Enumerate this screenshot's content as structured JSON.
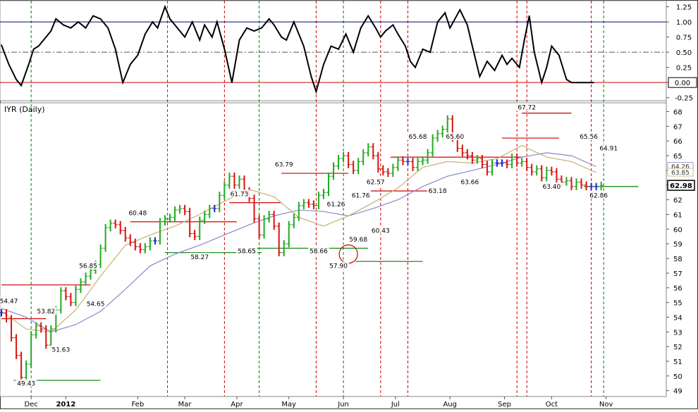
{
  "chart_data": [
    {
      "type": "line",
      "panel": "oscillator",
      "title": "",
      "y_ticks": [
        "1.25",
        "1.00",
        "0.75",
        "0.50",
        "0.25",
        "0.00",
        "-0.25"
      ],
      "ylim": [
        -0.3,
        1.35
      ],
      "reference_lines": [
        {
          "value": 1.0,
          "style": "solid",
          "color": "#000080"
        },
        {
          "value": 0.5,
          "style": "dashdot",
          "color": "#555555"
        },
        {
          "value": 0.0,
          "style": "solid",
          "color": "#cc0000"
        }
      ],
      "current_value_label": "0.00",
      "series": [
        {
          "x": [
            0,
            3,
            6,
            8,
            11,
            13,
            15,
            17,
            20,
            22,
            25,
            28,
            31,
            34,
            37,
            40,
            43,
            46,
            49,
            52,
            55,
            58,
            61,
            63,
            66,
            68,
            71,
            74,
            77,
            80,
            82,
            85,
            87,
            90,
            93,
            96,
            99,
            102,
            105,
            108,
            110,
            113,
            115,
            118,
            120,
            122,
            125,
            127,
            130,
            133,
            136,
            139,
            142,
            145,
            148,
            151,
            153,
            155,
            158,
            160,
            163,
            165,
            167,
            170,
            173,
            176,
            179,
            181,
            183,
            185,
            188,
            190,
            193,
            196,
            199,
            202,
            204,
            206,
            209,
            211,
            213,
            215,
            218,
            220,
            222,
            225,
            228,
            230,
            232,
            234,
            236,
            239
          ],
          "values": [
            0.62,
            0.3,
            0.05,
            -0.05,
            0.3,
            0.55,
            0.6,
            0.7,
            0.85,
            1.05,
            0.95,
            0.9,
            1.0,
            0.9,
            1.1,
            1.05,
            0.9,
            0.55,
            0.0,
            0.3,
            0.45,
            0.8,
            1.0,
            0.9,
            1.25,
            1.05,
            0.9,
            0.75,
            1.0,
            0.7,
            0.95,
            0.75,
            1.0,
            0.55,
            0.0,
            0.7,
            0.9,
            0.85,
            0.9,
            1.05,
            0.95,
            0.75,
            0.7,
            1.0,
            0.8,
            0.6,
            0.1,
            -0.15,
            0.3,
            0.6,
            0.55,
            0.8,
            0.5,
            0.9,
            1.1,
            0.9,
            0.75,
            0.85,
            0.95,
            0.8,
            0.6,
            0.35,
            0.25,
            0.55,
            0.5,
            1.0,
            1.15,
            0.9,
            1.05,
            1.2,
            0.95,
            0.6,
            0.1,
            0.35,
            0.2,
            0.45,
            0.3,
            0.4,
            0.25,
            0.7,
            1.1,
            0.5,
            0.0,
            0.25,
            0.6,
            0.45,
            0.05,
            0.0,
            0.0,
            0.0,
            0.0,
            0.0
          ]
        }
      ]
    },
    {
      "type": "line",
      "panel": "price",
      "title": "IYR (Daily)",
      "x_ticks": [
        {
          "label": "Dec",
          "x": 12
        },
        {
          "label": "2012",
          "x": 26
        },
        {
          "label": "Feb",
          "x": 55
        },
        {
          "label": "Mar",
          "x": 74
        },
        {
          "label": "Apr",
          "x": 95
        },
        {
          "label": "May",
          "x": 116
        },
        {
          "label": "Jun",
          "x": 138
        },
        {
          "label": "Jul",
          "x": 159
        },
        {
          "label": "Aug",
          "x": 181
        },
        {
          "label": "Sep",
          "x": 203
        },
        {
          "label": "Oct",
          "x": 222
        },
        {
          "label": "Nov",
          "x": 244
        }
      ],
      "xlim": [
        0,
        264
      ],
      "ylim": [
        48.6,
        68.6
      ],
      "y_ticks": [
        "68",
        "67",
        "66",
        "65",
        "64",
        "63",
        "62",
        "61",
        "60",
        "59",
        "58",
        "57",
        "56",
        "55",
        "54",
        "53",
        "52",
        "51",
        "50",
        "49"
      ],
      "series": [
        {
          "name": "",
          "x": [
            0,
            2,
            4,
            6,
            8,
            10,
            12,
            14,
            16,
            18,
            20,
            22,
            24,
            26,
            28,
            30,
            32,
            34,
            36,
            38,
            40,
            42,
            44,
            46,
            48,
            50,
            52,
            54,
            56,
            58,
            60,
            62,
            64,
            66,
            68,
            70,
            72,
            74,
            76,
            78,
            80,
            82,
            84,
            86,
            88,
            90,
            92,
            94,
            96,
            98,
            100,
            102,
            104,
            106,
            108,
            110,
            112,
            114,
            116,
            118,
            120,
            122,
            124,
            126,
            128,
            130,
            132,
            134,
            136,
            138,
            140,
            142,
            144,
            146,
            148,
            150,
            152,
            154,
            156,
            158,
            160,
            162,
            164,
            166,
            168,
            170,
            172,
            174,
            176,
            178,
            180,
            182,
            184,
            186,
            188,
            190,
            192,
            194,
            196,
            198,
            200,
            202,
            204,
            206,
            208,
            210,
            212,
            214,
            216,
            218,
            220,
            222,
            224,
            226,
            228,
            230,
            232,
            234,
            236,
            238,
            240,
            242
          ],
          "values": [
            54.3,
            53.9,
            52.6,
            51.4,
            49.9,
            50.8,
            52.8,
            53.4,
            53.2,
            52.1,
            53.2,
            54.5,
            55.8,
            55.4,
            55.0,
            55.9,
            56.4,
            56.8,
            57.2,
            57.6,
            58.7,
            60.1,
            60.4,
            60.3,
            59.9,
            59.4,
            59.1,
            58.8,
            58.6,
            58.8,
            59.2,
            59.2,
            60.5,
            60.7,
            60.8,
            61.3,
            61.4,
            61.2,
            59.7,
            59.5,
            60.6,
            61.0,
            61.4,
            61.4,
            62.3,
            63.0,
            63.6,
            63.0,
            63.4,
            62.6,
            62.1,
            60.7,
            59.6,
            60.7,
            61.0,
            60.2,
            58.4,
            59.0,
            60.3,
            60.8,
            61.6,
            61.8,
            61.7,
            61.6,
            62.3,
            62.5,
            63.6,
            64.3,
            64.8,
            65.0,
            64.4,
            64.0,
            64.6,
            65.2,
            65.6,
            65.0,
            64.1,
            63.9,
            63.8,
            64.2,
            64.7,
            64.6,
            64.6,
            64.2,
            64.6,
            64.7,
            65.2,
            66.2,
            66.5,
            66.8,
            67.5,
            66.2,
            65.5,
            65.2,
            65.0,
            64.7,
            64.8,
            64.4,
            63.9,
            64.5,
            64.5,
            64.5,
            64.4,
            64.9,
            64.5,
            64.6,
            64.2,
            63.9,
            64.1,
            63.5,
            64.0,
            63.9,
            63.4,
            63.2,
            63.3,
            62.9,
            63.2,
            63.0,
            62.9,
            62.9,
            62.9,
            62.98
          ]
        },
        {
          "name": "",
          "x": [
            0,
            10,
            20,
            30,
            40,
            50,
            60,
            70,
            80,
            90,
            100,
            110,
            120,
            130,
            140,
            150,
            160,
            170,
            180,
            190,
            200,
            210,
            220,
            230,
            240
          ],
          "values": [
            54.4,
            53.2,
            53.0,
            54.5,
            56.8,
            58.9,
            59.6,
            60.2,
            61.0,
            61.9,
            62.7,
            62.2,
            60.8,
            60.2,
            60.9,
            61.8,
            62.8,
            64.2,
            64.6,
            64.5,
            64.8,
            65.7,
            64.9,
            64.6,
            63.85
          ]
        },
        {
          "name": "",
          "x": [
            0,
            10,
            20,
            30,
            40,
            50,
            60,
            70,
            80,
            90,
            100,
            110,
            120,
            130,
            140,
            150,
            160,
            170,
            180,
            190,
            200,
            210,
            220,
            230,
            240
          ],
          "values": [
            54.6,
            54.0,
            53.0,
            53.5,
            54.4,
            55.9,
            57.5,
            58.3,
            58.9,
            59.6,
            60.3,
            60.9,
            61.3,
            61.2,
            60.9,
            61.4,
            62.0,
            62.9,
            63.6,
            64.0,
            64.4,
            64.9,
            65.2,
            65.0,
            64.26
          ]
        }
      ],
      "last_price_label": "62.98",
      "right_labels": [
        "64.26",
        "63.85"
      ],
      "annotations": [
        {
          "label": "54.47",
          "x": 3,
          "y": 55.0
        },
        {
          "label": "53.82",
          "x": 18,
          "y": 54.3
        },
        {
          "label": "49.43",
          "x": 10,
          "y": 49.4
        },
        {
          "label": "51.63",
          "x": 24,
          "y": 51.7
        },
        {
          "label": "56.85",
          "x": 35,
          "y": 57.4
        },
        {
          "label": "54.65",
          "x": 38,
          "y": 54.8
        },
        {
          "label": "60.48",
          "x": 55,
          "y": 61.0
        },
        {
          "label": "58.27",
          "x": 80,
          "y": 58.0
        },
        {
          "label": "61.73",
          "x": 96,
          "y": 62.3
        },
        {
          "label": "58.65",
          "x": 99,
          "y": 58.4
        },
        {
          "label": "63.79",
          "x": 114,
          "y": 64.3
        },
        {
          "label": "58.66",
          "x": 128,
          "y": 58.4
        },
        {
          "label": "61.26",
          "x": 135,
          "y": 61.6
        },
        {
          "label": "59.68",
          "x": 144,
          "y": 59.2
        },
        {
          "label": "57.90",
          "x": 136,
          "y": 57.4
        },
        {
          "label": "61.76",
          "x": 145,
          "y": 62.2
        },
        {
          "label": "62.57",
          "x": 151,
          "y": 63.1
        },
        {
          "label": "60.43",
          "x": 153,
          "y": 59.8
        },
        {
          "label": "65.68",
          "x": 168,
          "y": 66.2
        },
        {
          "label": "63.18",
          "x": 176,
          "y": 62.5
        },
        {
          "label": "65.60",
          "x": 183,
          "y": 66.2
        },
        {
          "label": "63.66",
          "x": 189,
          "y": 63.1
        },
        {
          "label": "67.72",
          "x": 212,
          "y": 68.2
        },
        {
          "label": "63.40",
          "x": 222,
          "y": 62.8
        },
        {
          "label": "65.56",
          "x": 237,
          "y": 66.2
        },
        {
          "label": "64.91",
          "x": 245,
          "y": 65.4
        },
        {
          "label": "62.86",
          "x": 241,
          "y": 62.2
        }
      ],
      "support_resistance_lines": [
        {
          "color": "#cc0000",
          "x1": 0,
          "x2": 36,
          "y": 56.2
        },
        {
          "color": "#cc0000",
          "x1": 0,
          "x2": 18,
          "y": 53.9
        },
        {
          "color": "#008000",
          "x1": 5,
          "x2": 40,
          "y": 49.7
        },
        {
          "color": "#cc0000",
          "x1": 52,
          "x2": 95,
          "y": 60.5
        },
        {
          "color": "#008000",
          "x1": 66,
          "x2": 105,
          "y": 58.4
        },
        {
          "color": "#cc0000",
          "x1": 92,
          "x2": 113,
          "y": 61.8
        },
        {
          "color": "#008000",
          "x1": 100,
          "x2": 148,
          "y": 58.7
        },
        {
          "color": "#cc0000",
          "x1": 113,
          "x2": 140,
          "y": 63.8
        },
        {
          "color": "#008000",
          "x1": 143,
          "x2": 170,
          "y": 57.8
        },
        {
          "color": "#cc0000",
          "x1": 149,
          "x2": 175,
          "y": 62.6
        },
        {
          "color": "#cc0000",
          "x1": 157,
          "x2": 210,
          "y": 64.9
        },
        {
          "color": "#cc0000",
          "x1": 202,
          "x2": 225,
          "y": 66.2
        },
        {
          "color": "#cc0000",
          "x1": 210,
          "x2": 230,
          "y": 67.9
        },
        {
          "color": "#008000",
          "x1": 235,
          "x2": 257,
          "y": 62.9
        }
      ],
      "vertical_lines": [
        {
          "x": 12,
          "color": "#008000"
        },
        {
          "x": 67,
          "color": "#008000"
        },
        {
          "x": 90,
          "color": "#cc0000"
        },
        {
          "x": 104,
          "color": "#008000"
        },
        {
          "x": 127,
          "color": "#cc0000"
        },
        {
          "x": 138,
          "color": "#008000"
        },
        {
          "x": 153,
          "color": "#cc0000"
        },
        {
          "x": 164,
          "color": "#cc0000"
        },
        {
          "x": 208,
          "color": "#cc0000"
        },
        {
          "x": 212,
          "color": "#cc0000"
        },
        {
          "x": 238,
          "color": "#cc0000"
        },
        {
          "x": 243,
          "color": "#008000"
        }
      ],
      "circle_annotation": {
        "x": 140,
        "y": 58.3
      },
      "colors": {
        "up": "#22aa22",
        "down": "#dd1111",
        "neutral": "#2222cc",
        "ma_fast": "#c8b070",
        "ma_slow": "#8888cc"
      }
    }
  ]
}
